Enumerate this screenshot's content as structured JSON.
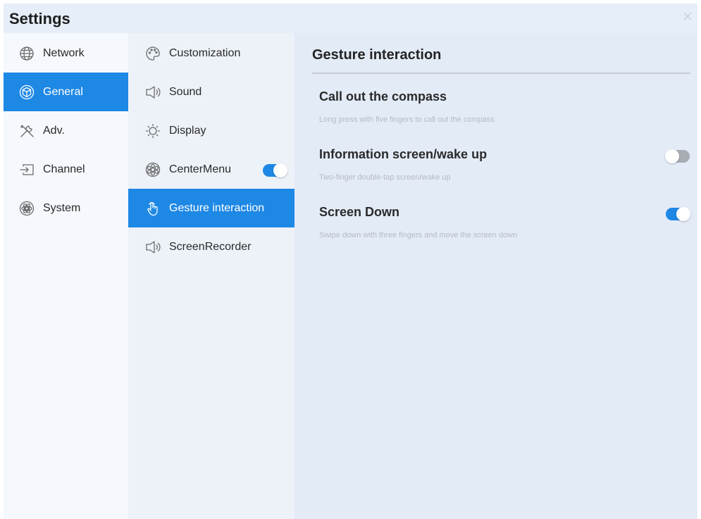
{
  "window": {
    "title": "Settings"
  },
  "categories": [
    {
      "label": "Network",
      "icon": "globe-icon",
      "active": false
    },
    {
      "label": "General",
      "icon": "cube-icon",
      "active": true
    },
    {
      "label": "Adv.",
      "icon": "tools-icon",
      "active": false
    },
    {
      "label": "Channel",
      "icon": "input-source-icon",
      "active": false
    },
    {
      "label": "System",
      "icon": "system-icon",
      "active": false
    }
  ],
  "subitems": [
    {
      "label": "Customization",
      "icon": "palette-icon",
      "active": false
    },
    {
      "label": "Sound",
      "icon": "speaker-icon",
      "active": false
    },
    {
      "label": "Display",
      "icon": "sun-icon",
      "active": false
    },
    {
      "label": "CenterMenu",
      "icon": "wheel-icon",
      "active": false,
      "toggle": "on"
    },
    {
      "label": "Gesture interaction",
      "icon": "hand-pointer-icon",
      "active": true
    },
    {
      "label": "ScreenRecorder",
      "icon": "speaker-icon",
      "active": false
    }
  ],
  "panel": {
    "heading": "Gesture interaction",
    "options": [
      {
        "title": "Call out the compass",
        "desc": "Long press with five fingers to call out the compass",
        "toggle": "none"
      },
      {
        "title": "Information screen/wake up",
        "desc": "Two-finger double-tap screen/wake up",
        "toggle": "off"
      },
      {
        "title": "Screen Down",
        "desc": "Swipe down with three fingers and move the screen down",
        "toggle": "on"
      }
    ]
  },
  "colors": {
    "accent": "#1e88e5",
    "toggle_off": "#a8adb4",
    "background": "#e6eefa"
  }
}
